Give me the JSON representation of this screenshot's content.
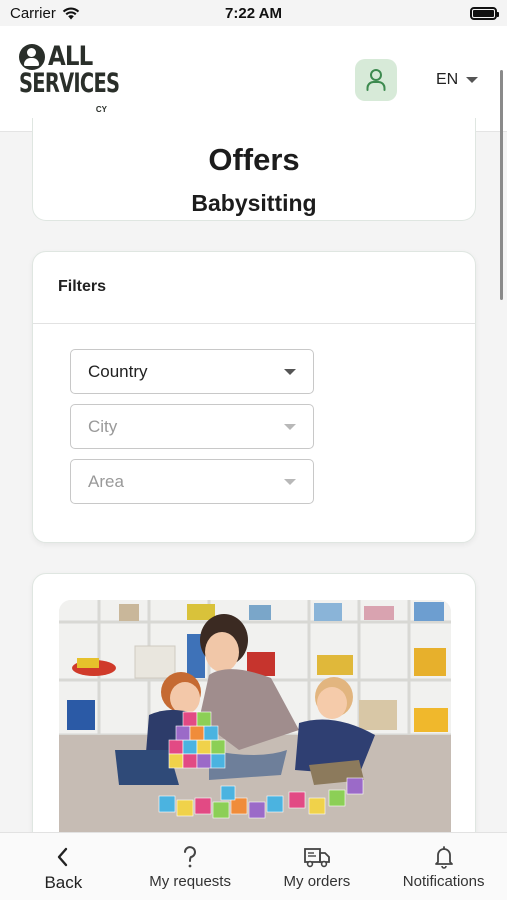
{
  "status_bar": {
    "carrier": "Carrier",
    "time": "7:22 AM"
  },
  "header": {
    "logo": {
      "line1": "ALL",
      "line2": "SERVICES",
      "suffix": "CY"
    },
    "language": "EN",
    "profile_icon": "user-icon"
  },
  "page": {
    "title": "Offers",
    "subtitle": "Babysitting"
  },
  "filters": {
    "heading": "Filters",
    "country_placeholder": "Country",
    "city_placeholder": "City",
    "area_placeholder": "Area"
  },
  "offer": {
    "image": "babysitter-with-children-playing-blocks"
  },
  "bottom_nav": {
    "back": "Back",
    "requests": "My requests",
    "orders": "My orders",
    "notifications": "Notifications"
  },
  "colors": {
    "accent": "#d7ead8",
    "accent_icon": "#3d8a4f",
    "text": "#222222"
  }
}
